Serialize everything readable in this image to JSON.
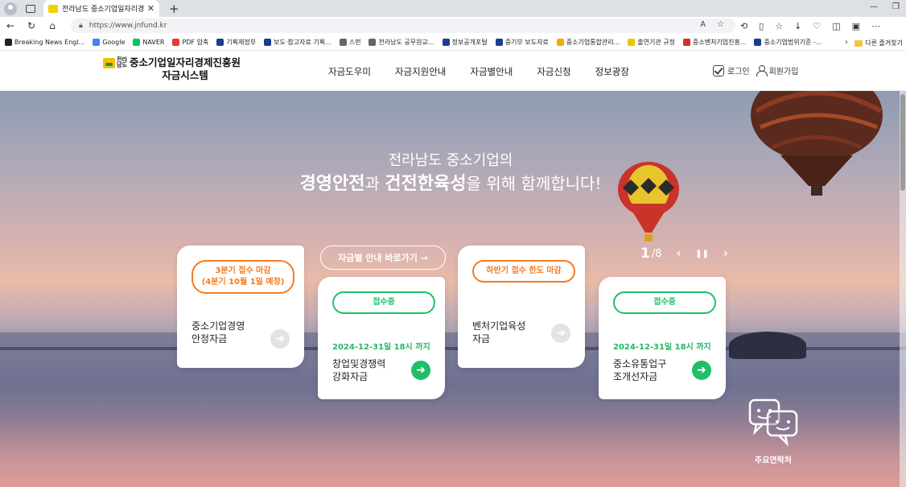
{
  "browser": {
    "tab_title": "전라남도 중소기업일자리경제진흥원",
    "tab_close": "✕",
    "new_tab": "+",
    "url": "https://www.jnfund.kr",
    "bookmarks": [
      {
        "label": "Breaking News Engl...",
        "color": "#222222"
      },
      {
        "label": "Google",
        "color": "#4285f4"
      },
      {
        "label": "NAVER",
        "color": "#03c75a"
      },
      {
        "label": "PDF 압축",
        "color": "#e53935"
      },
      {
        "label": "기획재정부",
        "color": "#1a3d8f"
      },
      {
        "label": "보도·참고자료 기획...",
        "color": "#1a3d8f"
      },
      {
        "label": "스펀",
        "color": "#666666"
      },
      {
        "label": "전라남도 공무원교...",
        "color": "#666666"
      },
      {
        "label": "정보공개포털",
        "color": "#1a3d8f"
      },
      {
        "label": "중기부 보도자료",
        "color": "#1a3d8f"
      },
      {
        "label": "중소기업통합관리...",
        "color": "#f2a900"
      },
      {
        "label": "출연기관 규정",
        "color": "#f2c200"
      },
      {
        "label": "중소벤처기업진흥...",
        "color": "#d32f2f"
      },
      {
        "label": "중소기업범위기준 -...",
        "color": "#1a3d8f"
      }
    ],
    "other_bookmarks": "다른 즐겨찾기"
  },
  "header": {
    "logo_region": "전라남도",
    "logo_line1": "중소기업일자리경제진흥원",
    "logo_line2": "자금시스템",
    "nav": [
      "자금도우미",
      "자금지원안내",
      "자금별안내",
      "자금신청",
      "정보광장"
    ],
    "login": "로그인",
    "signup": "회원가입"
  },
  "hero": {
    "line1": "전라남도 중소기업의",
    "line2_b1": "경영안전",
    "line2_t1": "과 ",
    "line2_b2": "건전한육성",
    "line2_t2": "을 위해 함께합니다!",
    "jump_link": "자금별 안내 바로가기 →",
    "slide_current": "1",
    "slide_total": "/8",
    "prev": "‹",
    "pause": "❚❚",
    "next": "›"
  },
  "cards": [
    {
      "badge": "3분기 접수 마감\n(4분기 10월 1일 예정)",
      "badge_line1": "3분기 접수 마감",
      "badge_line2": "(4분기 10월 1일 예정)",
      "title1": "중소기업경영",
      "title2": "안정자금",
      "date": ""
    },
    {
      "badge_line1": "접수중",
      "title1": "창업및경쟁력",
      "title2": "강화자금",
      "date": "2024-12-31일 18시 까지"
    },
    {
      "badge_line1": "하반기 접수 한도 마감",
      "title1": "벤처기업육성",
      "title2": "자금",
      "date": ""
    },
    {
      "badge_line1": "접수중",
      "title1": "중소유통업구",
      "title2": "조개선자금",
      "date": "2024-12-31일 18시 까지"
    }
  ],
  "contact": {
    "label": "주요연락처"
  },
  "colors": {
    "orange": "#f47b20",
    "green": "#1fbf6a"
  }
}
